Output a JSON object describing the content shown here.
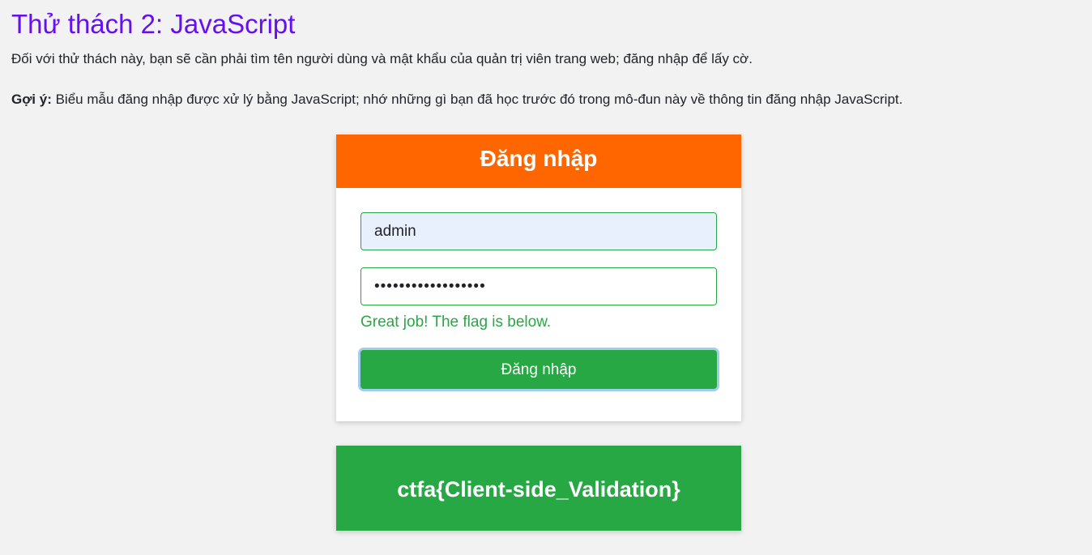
{
  "page": {
    "title": "Thử thách 2: JavaScript",
    "description": "Đối với thử thách này, bạn sẽ cần phải tìm tên người dùng và mật khẩu của quản trị viên trang web; đăng nhập để lấy cờ.",
    "hint_label": "Gợi ý:",
    "hint_text": " Biểu mẫu đăng nhập được xử lý bằng JavaScript; nhớ những gì bạn đã học trước đó trong mô-đun này về thông tin đăng nhập JavaScript."
  },
  "login": {
    "header": "Đăng nhập",
    "username_value": "admin",
    "password_value": "••••••••••••••••••",
    "message": "Great job! The flag is below.",
    "submit_label": "Đăng nhập"
  },
  "flag": {
    "text": "ctfa{Client-side_Validation}"
  },
  "colors": {
    "title": "#6610f2",
    "header_bg": "#ff6600",
    "success": "#28a745",
    "autofill_bg": "#e8f0fe",
    "page_bg": "#f2f2f2"
  }
}
